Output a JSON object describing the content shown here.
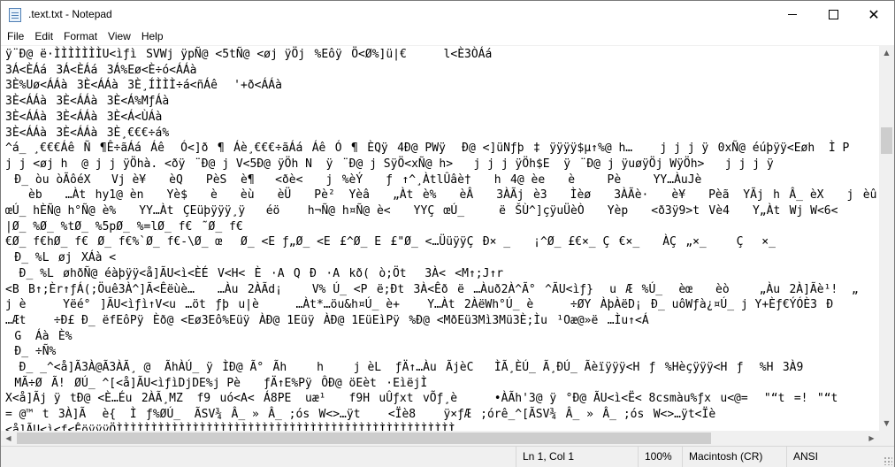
{
  "window": {
    "title": ".text.txt - Notepad",
    "icon": "notepad-icon",
    "controls": {
      "minimize": "minimize-icon",
      "maximize": "maximize-icon",
      "close": "✕"
    }
  },
  "menu": [
    "File",
    "Edit",
    "Format",
    "View",
    "Help"
  ],
  "editor": {
    "lines": [
      "ÿ¨Ð@ ë·ÌÌÌÌÌÌÌU<ìƒìSVWj ÿpÑ@ <5tÑ@ <øj ÿÖj%EôÿÖ<Ø%]ü|€    l<È3ÒÁá",
      "3Á<ÈÁá3Á<ÈÁá3Á%Eø<È÷ó<ÁÁà",
      "3È%Uø<ÁÁà3È<ÁÁà3È¸ÍÌÌÌ÷á<ñÁê '+ð<ÁÁà",
      "3È<ÁÁà3È<ÁÁà3È<Á%MƒÁà",
      "3È<ÁÁà3È<ÁÁà3È<Á<ÙÁà",
      "3È<ÁÁà3È<ÁÁà3È¸€€€÷á%",
      "^á_ ¸€€€ÁêÑ¶Ê÷ãÁáÁê Ó<]ð¶Áè¸€€€÷ãÁáÁêÓ¶ÈQÿ4Ð@ PWÿ Ð@ <]üNƒþ‡ÿÿÿÿ$µ↑%@ h…    j j j ÿ0xÑ@ éúþÿÿ<Eøh  Ì P",
      "j j <øj h  @ j j ÿÖhà. <ðÿ¨Ð@ j V<5Ð@ ÿÖh N  ÿ¨Ð@ j SÿÖ<xÑ@ h>   j j j ÿÖh$E  ÿ¨Ð@ j ÿuøÿÖj WÿÖh>   j j j ÿ",
      "Ð_ òu òÃôéX   Vj è¥  èQ  PèS  è¶   <ðè<  j%èÝ  ƒ↑^¸ÀtlÛâè†  h4@ èe  è  Pè  YY…ÀuJè",
      "  èb  …Àthy1@ èn  Yè$  è  èù  èÜ  Pè²  Yèâ  „Àtè%  èÂ  3ÀÃjè3  Ìèø  3ÀÃè·  è¥  Pèã  YÃjhÂ_ èX  jèû",
      "œÚ_ hÈÑ@ h°Ñ@ è%  YY…ÀtÇEüþÿÿÿ¸ÿ   éö    h¬Ñ@ h¤Ñ@ è<  YYÇœÚ_     ëŠÙ^]çÿuÜèÒ  Yèp  <ð3ÿ9>tVè4  Y„ÀtWj W<6<",
      "|Ø_ %Ø_ %tØ_ %5pØ_ %=lØ_ f€˜Ø_ f€",
      "€Ø_ f€hØ_ f€Ø_ f€%`Ø_ f€-\\Ø_ œØ_ <E ƒ„Ø_ <E£^Ø_ E£\"Ø_ <…ÜüÿÿÇÐ× _  ¡^Ø_ £€×_ Ç€×_  ÀÇ„×_   Ç×_ ",
      "Ð_ %LøjXÁà <",
      "  Ð_ %LøhðÑ@ éàþÿÿ<å]ÃU<ì<ÈÉV<H<È·AQÐ·Akð(ò;Öt3À<<M↑;J↑r",
      "<BB↑;Èr↑ƒÁ(;Öuê3À^]Ã<Êëùè…  …Àu2ÀÃd¡   V% Ú_ <Pë;Ðt3À<Êðë…Àuð2À^Ã°^ÃU<ìƒ} uÆ%Ú_ èœ  èò   „Àu2À]Ãè¹!  „",
      "j è    Yëé°]ÃU<ìƒì↑V<u…ötƒþu|è    …Àt*…öu&h¤Ú_ è+    Y…Àt2ÀëWh°Ú_ è    ÷ØYÀþÀëD¡Ð_ uôWƒà¿¤Ú_ j Y+Èƒ€ÝÓÈ3Ð",
      "…Æt    ÷Ð£ Ð_ ëfEôPÿÈð@ <Eø3Eô%EüÿÀÐ@ 1EüÿÀÐ@ 1EüEìPÿ%Ð@ <MðEü3Mì3Mü3È;Ìu¹Oæ@»ë…Ìu↑<Á",
      "G  ÁàÈ%",
      "Ð_ ÷Ñ%",
      "  Ð_ _^<å]Ã3À@Ã3ÀÃ¸ @  ÃhÀÚ_ ÿÌÐ@ Ã°Ãh   h   j èL  ƒÄ↑…ÀuÃjèC   ÌÃ¸ÈÚ_ Ã¸ÐÚ_ Ãèïÿÿÿ<Hƒ%Hèçÿÿÿ<Hƒ %H3À9",
      "MÃ÷ØÃ!ØÚ_ ^[<å]ÃU<ìƒìDjDE%j Pè  ƒÄ↑E%PÿÔÐ@ öEèt·EìëjÌ",
      "X<å]Ãj ÿtÐ@ <È…Éu2ÀÃ¸MZ  f9uó<A<Á8PE  uæ¹  f9HuÛƒxtvÕƒ¸è    •ÀÃh'3@ ÿ°Ð@ ÃU<ì<Ë< 8csmàu%ƒxu<@= \"“t=!\"“t",
      "= @™t3À]Ã è{  Ìƒ%ØÚ_  ÃSV¾Â_ »Â_ ;ósW<>…ÿt    <Ïè8    ÿ×ƒÆ;órê_^[ÃSV¾Â_ »Â_ ;ósW<>…ÿt<Ïè",
      "<å]ÃU<ì<ƒ<ÊöÿÿÿÖÌÌÌÌÌÌÌÌÌÌÌÌÌÌÌÌÌÌÌÌÌÌÌÌÌÌÌÌÌÌÌÌÌÌÌÌÌÌÌÌÌÌÌÌÌÌÌÌÌ"
    ]
  },
  "status": {
    "position": "Ln 1, Col 1",
    "zoom": "100%",
    "line_ending": "Macintosh (CR)",
    "encoding": "ANSI"
  }
}
